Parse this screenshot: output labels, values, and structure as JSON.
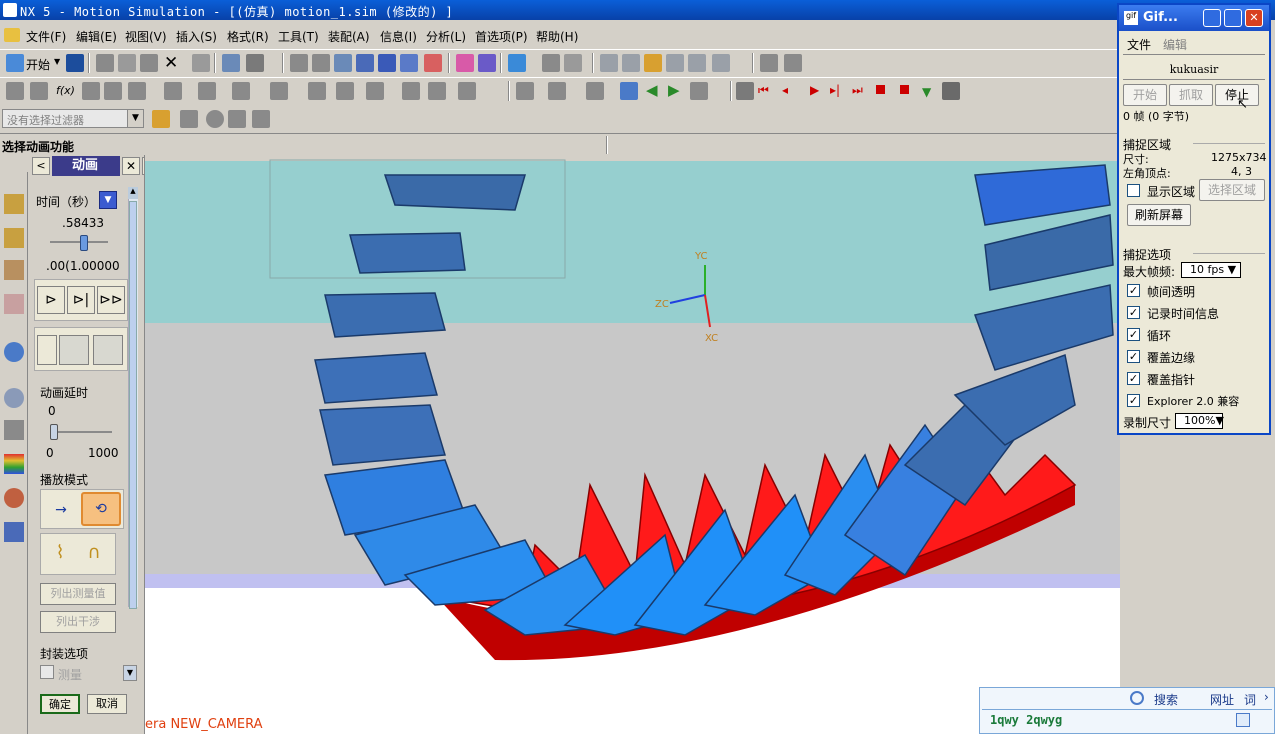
{
  "window": {
    "title": "NX 5 - Motion Simulation - [(仿真) motion_1.sim  (修改的) ]"
  },
  "menu": [
    {
      "label": "文件(F)"
    },
    {
      "label": "编辑(E)"
    },
    {
      "label": "视图(V)"
    },
    {
      "label": "插入(S)"
    },
    {
      "label": "格式(R)"
    },
    {
      "label": "工具(T)"
    },
    {
      "label": "装配(A)"
    },
    {
      "label": "信息(I)"
    },
    {
      "label": "分析(L)"
    },
    {
      "label": "首选项(P)"
    },
    {
      "label": "帮助(H)"
    }
  ],
  "toolbar": {
    "start_label": "开始"
  },
  "filter": {
    "placeholder": "没有选择过滤器"
  },
  "status": {
    "prompt": "选择动画功能"
  },
  "panel": {
    "tab_title": "动画",
    "time_label": "时间（秒）",
    "time_value": ".58433",
    "range_min": ".00(",
    "range_max": "1.00000",
    "delay_label": "动画延时",
    "delay_value": "0",
    "delay_min": "0",
    "delay_max": "1000",
    "delay_fraction": 0.0,
    "time_fraction": 0.58,
    "play_mode_label": "播放模式",
    "list_measure": "列出测量值",
    "list_interference": "列出干涉",
    "package_options": "封装选项",
    "measure_label": "测量",
    "ok": "确定",
    "cancel": "取消"
  },
  "viewport": {
    "camera_label": "era NEW_CAMERA",
    "axes": {
      "yc": "YC",
      "zc": "ZC",
      "xc": "XC"
    },
    "colors": {
      "bg_top": "#96cfcf",
      "bg_mid": "#c8c8c8",
      "bg_low": "#ffffff",
      "gear_blue": "#2f7fe0",
      "gear_red": "#ff1a1a"
    }
  },
  "gif": {
    "title": "Gif...",
    "menu": {
      "file": "文件",
      "edit": "编辑"
    },
    "user": "kukuasir",
    "buttons": {
      "start": "开始",
      "capture": "抓取",
      "stop": "停止",
      "refresh": "刷新屏幕",
      "select_region": "选择区域"
    },
    "frames": "0 帧 (0 字节)",
    "capture_region": "捕捉区域",
    "size_label": "尺寸:",
    "size_value": "1275x734",
    "corner_label": "左角顶点:",
    "corner_value": "4, 3",
    "show_region": "显示区域",
    "capture_options": "捕捉选项",
    "max_fps_label": "最大帧频:",
    "max_fps_value": "10 fps",
    "options": [
      {
        "label": "帧间透明",
        "checked": true
      },
      {
        "label": "记录时间信息",
        "checked": true
      },
      {
        "label": "循环",
        "checked": true
      },
      {
        "label": "覆盖边缘",
        "checked": true
      },
      {
        "label": "覆盖指针",
        "checked": true
      },
      {
        "label": "Explorer 2.0 兼容",
        "checked": true
      }
    ],
    "record_size_label": "录制尺寸",
    "record_size_value": "100%"
  },
  "searchbar": {
    "search": "搜索",
    "url": "网址",
    "word": "词",
    "input": "1qwy 2qwyg"
  }
}
